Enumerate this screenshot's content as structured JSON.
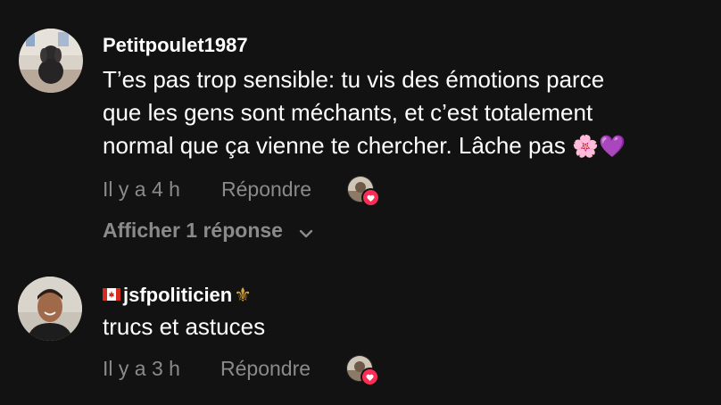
{
  "comments": [
    {
      "username": "Petitpoulet1987",
      "text_line1": "T’es pas trop sensible: tu vis des émotions parce",
      "text_line2": "que les gens sont méchants, et c’est totalement",
      "text_line3": "normal que ça vienne te chercher. Lâche pas ",
      "emojis": "🌸💜",
      "time": "Il y a 4 h",
      "reply_label": "Répondre",
      "show_replies_label": "Afficher 1 réponse",
      "creator_liked": true
    },
    {
      "username": "jsfpoliticien",
      "username_prefix_icon": "canada-flag-icon",
      "username_suffix": "⚜",
      "text": "trucs et astuces",
      "time": "Il y a 3 h",
      "reply_label": "Répondre",
      "creator_liked": true
    }
  ],
  "colors": {
    "background": "#121212",
    "primary_text": "#ffffff",
    "secondary_text": "#8a8a8a",
    "heart": "#fe2c55"
  }
}
